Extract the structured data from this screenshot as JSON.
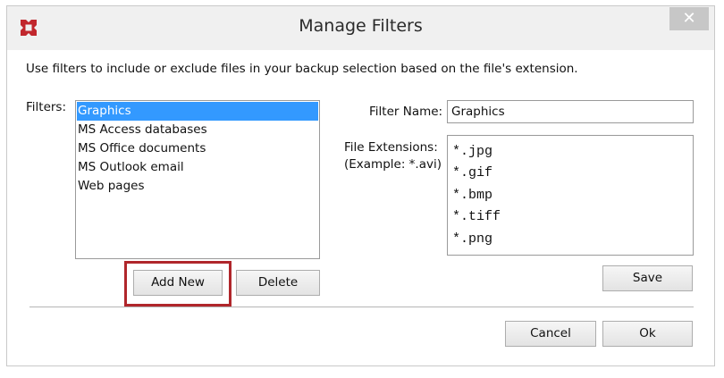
{
  "window": {
    "title": "Manage Filters",
    "close_label": "✕"
  },
  "instructions": "Use filters to include or exclude files in your backup selection based on the file's extension.",
  "filters": {
    "label": "Filters:",
    "items": [
      {
        "label": "Graphics",
        "selected": true
      },
      {
        "label": "MS Access databases",
        "selected": false
      },
      {
        "label": "MS Office documents",
        "selected": false
      },
      {
        "label": "MS Outlook email",
        "selected": false
      },
      {
        "label": "Web pages",
        "selected": false
      }
    ],
    "add_new_label": "Add New",
    "delete_label": "Delete"
  },
  "filter_name": {
    "label": "Filter Name:",
    "value": "Graphics"
  },
  "file_extensions": {
    "label": "File Extensions:",
    "example": "(Example: *.avi)",
    "lines": [
      "*.jpg",
      "*.gif",
      "*.bmp",
      "*.tiff",
      "*.png"
    ]
  },
  "save_label": "Save",
  "cancel_label": "Cancel",
  "ok_label": "Ok",
  "colors": {
    "selection": "#3399ff",
    "highlight_border": "#b0262b",
    "app_icon": "#c1272d"
  }
}
